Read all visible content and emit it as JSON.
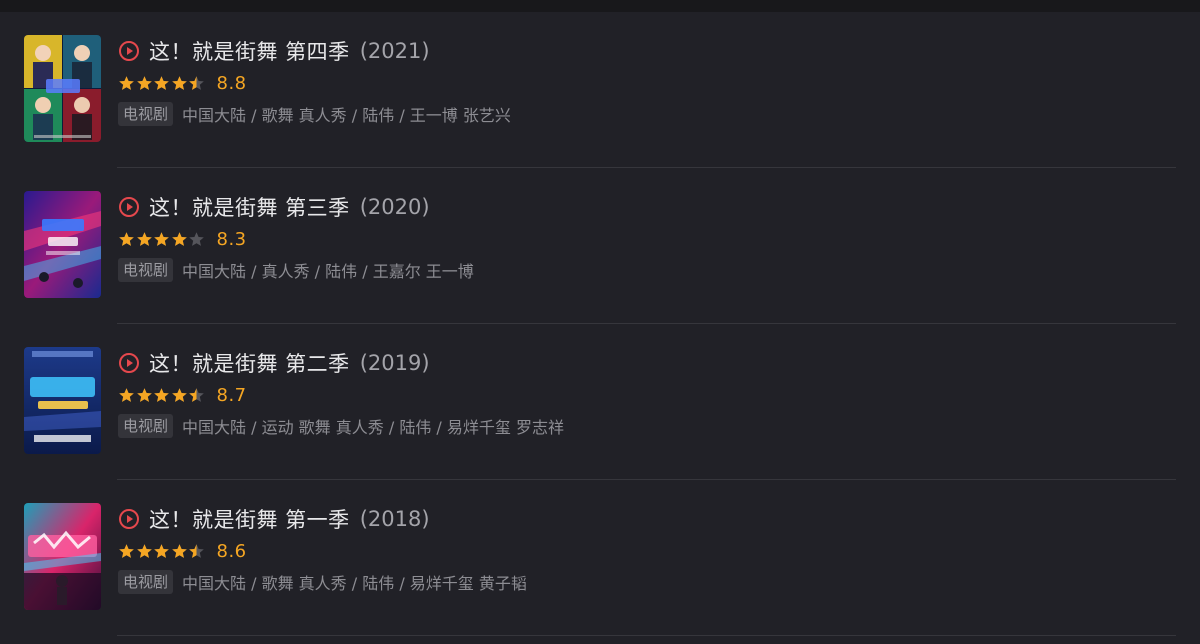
{
  "colors": {
    "background": "#212127",
    "play_icon": "#e5484d",
    "star_filled": "#f5a623",
    "star_empty": "#55555b",
    "score": "#f5a623"
  },
  "shows": [
    {
      "title": "这！就是街舞 第四季",
      "year": "(2021)",
      "stars": 4.5,
      "score": "8.8",
      "badge": "电视剧",
      "meta": "中国大陆 / 歌舞 真人秀 / 陆伟 / 王一博 张艺兴",
      "poster_icon": "poster-season-4"
    },
    {
      "title": "这！就是街舞 第三季",
      "year": "(2020)",
      "stars": 4,
      "score": "8.3",
      "badge": "电视剧",
      "meta": "中国大陆 / 真人秀 / 陆伟 / 王嘉尔 王一博",
      "poster_icon": "poster-season-3"
    },
    {
      "title": "这！就是街舞 第二季",
      "year": "(2019)",
      "stars": 4.5,
      "score": "8.7",
      "badge": "电视剧",
      "meta": "中国大陆 / 运动 歌舞 真人秀 / 陆伟 / 易烊千玺 罗志祥",
      "poster_icon": "poster-season-2"
    },
    {
      "title": "这！就是街舞 第一季",
      "year": "(2018)",
      "stars": 4.5,
      "score": "8.6",
      "badge": "电视剧",
      "meta": "中国大陆 / 歌舞 真人秀 / 陆伟 / 易烊千玺 黄子韬",
      "poster_icon": "poster-season-1"
    }
  ]
}
